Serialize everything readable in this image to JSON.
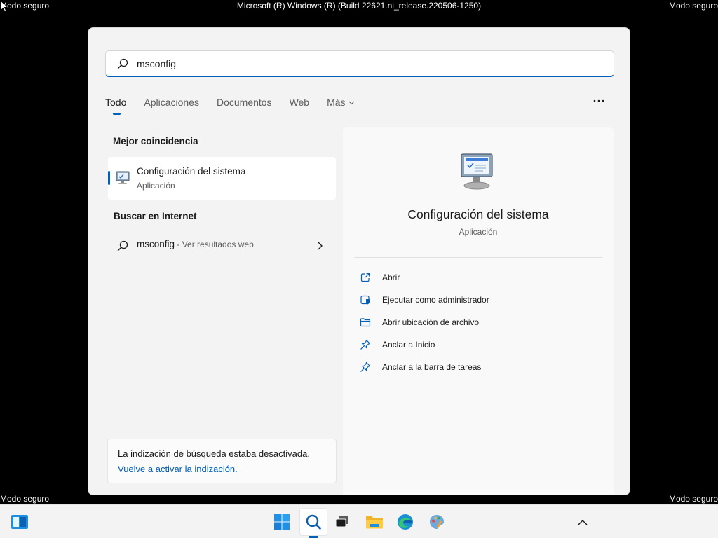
{
  "screen": {
    "safe_mode_label": "Modo seguro",
    "build_label": "Microsoft (R) Windows (R) (Build 22621.ni_release.220506-1250)"
  },
  "search": {
    "query": "msconfig"
  },
  "tabs": [
    {
      "label": "Todo",
      "active": true
    },
    {
      "label": "Aplicaciones"
    },
    {
      "label": "Documentos"
    },
    {
      "label": "Web"
    },
    {
      "label": "Más"
    }
  ],
  "results": {
    "best_match_title": "Mejor coincidencia",
    "best_match": {
      "name": "Configuración del sistema",
      "type": "Aplicación",
      "icon": "system-config-icon"
    },
    "web_title": "Buscar en Internet",
    "web_item": {
      "query": "msconfig",
      "suffix": " - Ver resultados web"
    }
  },
  "indexing": {
    "message": "La indización de búsqueda estaba desactivada.",
    "link": "Vuelve a activar la indización."
  },
  "preview": {
    "name": "Configuración del sistema",
    "type": "Aplicación",
    "actions": [
      {
        "label": "Abrir",
        "icon": "open-external-icon"
      },
      {
        "label": "Ejecutar como administrador",
        "icon": "run-as-admin-icon"
      },
      {
        "label": "Abrir ubicación de archivo",
        "icon": "folder-icon"
      },
      {
        "label": "Anclar a Inicio",
        "icon": "pin-icon"
      },
      {
        "label": "Anclar a la barra de tareas",
        "icon": "pin-icon"
      }
    ]
  },
  "taskbar": {
    "items": [
      "widgets-icon",
      "start-icon",
      "search-icon",
      "task-view-icon",
      "file-explorer-icon",
      "edge-icon",
      "paint-icon",
      "show-hidden-icons"
    ]
  },
  "colors": {
    "accent": "#005fb8",
    "background": "#000000",
    "panel": "#f3f3f3"
  }
}
